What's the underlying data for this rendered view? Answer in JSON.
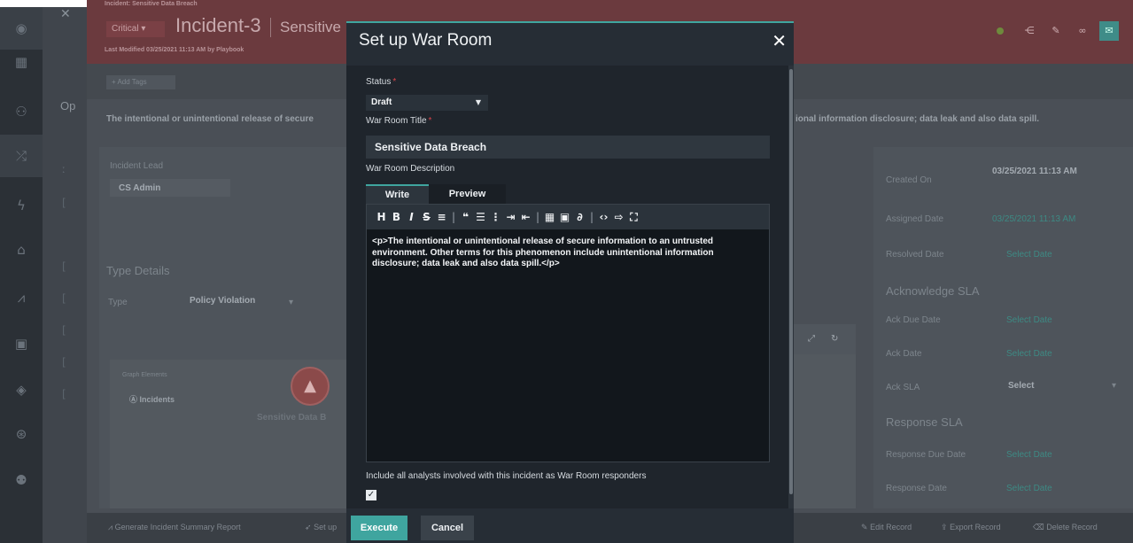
{
  "background": {
    "header": {
      "breadcrumb": "Incident: Sensitive Data Breach",
      "severity": "Critical",
      "incident_name": "Incident-3",
      "incident_subtitle": "Sensitive",
      "last_modified": "Last Modified 03/25/2021 11:13 AM by Playbook"
    },
    "add_tags": "+ Add Tags",
    "op_label": "Op",
    "description_left": "The intentional or unintentional release of secure",
    "description_right": "ional information disclosure; data leak and also data spill.",
    "incident_lead_label": "Incident Lead",
    "incident_lead_value": "CS Admin",
    "type_details_heading": "Type Details",
    "type_label": "Type",
    "type_value": "Policy Violation",
    "graph_elements_label": "Graph Elements",
    "graph_incidents": "Incidents",
    "graph_node_label": "Sensitive Data B",
    "right_panel": {
      "created_on_label": "Created On",
      "created_on_value": "03/25/2021 11:13 AM",
      "assigned_date_label": "Assigned Date",
      "assigned_date_value": "03/25/2021 11:13 AM",
      "resolved_date_label": "Resolved Date",
      "select_date": "Select Date",
      "ack_sla_heading": "Acknowledge SLA",
      "ack_due_date_label": "Ack Due Date",
      "ack_date_label": "Ack Date",
      "ack_sla_label": "Ack SLA",
      "ack_sla_value": "Select",
      "response_sla_heading": "Response SLA",
      "response_due_date_label": "Response Due Date",
      "response_date_label": "Response Date"
    },
    "bottom_bar": {
      "generate_report": "Generate Incident Summary Report",
      "set_up": "Set up",
      "edit_record": "Edit Record",
      "export_record": "Export Record",
      "delete_record": "Delete Record"
    }
  },
  "modal": {
    "title": "Set up War Room",
    "status_label": "Status",
    "status_value": "Draft",
    "title_label": "War Room Title",
    "title_value": "Sensitive Data Breach",
    "description_label": "War Room Description",
    "tabs": [
      "Write",
      "Preview"
    ],
    "toolbar_icons": [
      "heading-icon",
      "bold-icon",
      "italic-icon",
      "strikethrough-icon",
      "hr-icon",
      "quote-icon",
      "unordered-list-icon",
      "ordered-list-icon",
      "indent-icon",
      "outdent-icon",
      "table-icon",
      "image-icon",
      "link-icon",
      "code-icon",
      "insert-icon",
      "fullscreen-icon"
    ],
    "description_text": "<p>The intentional or unintentional release of secure information to an untrusted environment. Other terms for this phenomenon include unintentional information disclosure; data leak and also data spill.</p>",
    "include_analysts_label": "Include all analysts involved with this incident as War Room responders",
    "include_analysts_checked": true,
    "execute_label": "Execute",
    "cancel_label": "Cancel"
  },
  "colors": {
    "accent": "#3fa59f",
    "required": "#d8434a",
    "header_critical": "#6b3a3e",
    "modal_bg": "#1f252c"
  }
}
